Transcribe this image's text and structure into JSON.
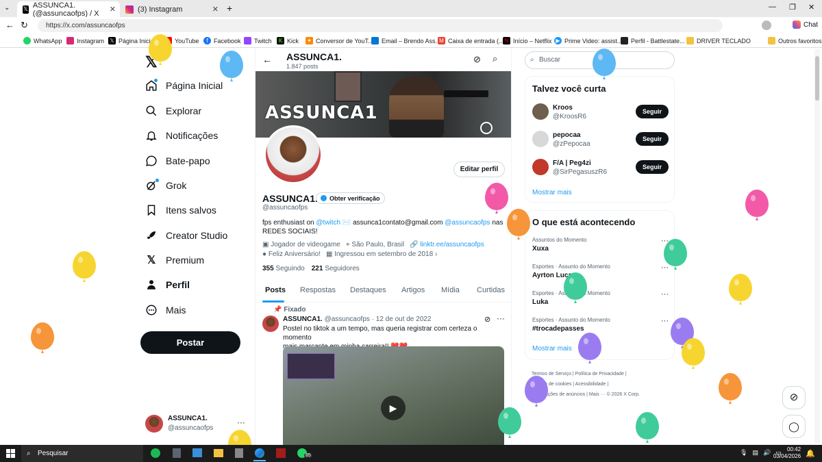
{
  "browser": {
    "tabs": [
      {
        "title": "ASSUNCA1. (@assuncaofps) / X"
      },
      {
        "title": "(3) Instagram"
      }
    ],
    "url": "https://x.com/assuncaofps",
    "chat_label": "Chat",
    "bookmarks": [
      "WhatsApp",
      "Instagram",
      "Página Inicial / X",
      "YouTube",
      "Facebook",
      "Twitch",
      "Kick",
      "Conversor de YouT...",
      "Email – Brendo Ass...",
      "Caixa de entrada (...",
      "Início – Netflix",
      "Prime Video: assist...",
      "Perfil - Battlestate...",
      "DRIVER TECLADO"
    ],
    "other_favorites": "Outros favoritos"
  },
  "sidebar": {
    "items": [
      {
        "label": "Página Inicial",
        "icon": "home-icon"
      },
      {
        "label": "Explorar",
        "icon": "search-icon"
      },
      {
        "label": "Notificações",
        "icon": "bell-icon"
      },
      {
        "label": "Bate-papo",
        "icon": "chat-icon"
      },
      {
        "label": "Grok",
        "icon": "grok-icon"
      },
      {
        "label": "Itens salvos",
        "icon": "bookmark-icon"
      },
      {
        "label": "Creator Studio",
        "icon": "rocket-icon"
      },
      {
        "label": "Premium",
        "icon": "x-logo-icon"
      },
      {
        "label": "Perfil",
        "icon": "person-icon"
      },
      {
        "label": "Mais",
        "icon": "more-icon"
      }
    ],
    "post_button": "Postar",
    "account": {
      "name": "ASSUNCA1.",
      "handle": "@assuncaofps"
    }
  },
  "profile": {
    "header_name": "ASSUNCA1.",
    "posts_count": "1.847 posts",
    "banner_text": "ASSUNCA1",
    "edit_button": "Editar perfil",
    "name": "ASSUNCA1.",
    "verify_button": "Obter verificação",
    "handle": "@assuncaofps",
    "bio_1": "fps enthusiast on",
    "bio_twitch": "@twitch",
    "bio_2": "assunca1contato@gmail.com",
    "bio_mention": "@assuncaofps",
    "bio_3": "nas",
    "bio_4": "REDES SOCIAIS!",
    "category": "Jogador de videogame",
    "location": "São Paulo, Brasil",
    "link": "linktr.ee/assuncaofps",
    "birthday": "Feliz Aniversário!",
    "joined": "Ingressou em setembro de 2018",
    "following_count": "355",
    "following_label": "Seguindo",
    "followers_count": "221",
    "followers_label": "Seguidores",
    "tabs": [
      "Posts",
      "Respostas",
      "Destaques",
      "Artigos",
      "Mídia",
      "Curtidas"
    ]
  },
  "pinned_post": {
    "pinned_label": "Fixado",
    "name": "ASSUNCA1.",
    "handle_date": "@assuncaofps · 12 de out de 2022",
    "text_1": "Postel no tiktok a um tempo, mas queria registrar com certeza o momento",
    "text_2": "mais marcante em minha carreira!! ❤️❤️"
  },
  "right": {
    "search_placeholder": "Buscar",
    "who_to_follow_title": "Talvez você curta",
    "suggestions": [
      {
        "name": "Kroos",
        "handle": "@KroosR6"
      },
      {
        "name": "pepocaa",
        "handle": "@zPepocaa"
      },
      {
        "name": "F/A | Peg4zi",
        "handle": "@SirPegasuszR6"
      }
    ],
    "follow_label": "Seguir",
    "show_more": "Mostrar mais",
    "trends_title": "O que está acontecendo",
    "trends": [
      {
        "context": "Assuntos do Momento",
        "topic": "Xuxa"
      },
      {
        "context": "Esportes · Assunto do Momento",
        "topic": "Ayrton Lucas"
      },
      {
        "context": "Esportes · Assunto do Momento",
        "topic": "Luka"
      },
      {
        "context": "Esportes · Assunto do Momento",
        "topic": "#trocadepasses"
      }
    ],
    "footer_1": "Termos de Serviço  |  Política de Privacidade  |",
    "footer_2": "Política de cookies  |  Acessibilidade  |",
    "footer_3": "Informações de anúncios  |  Mais ···  © 2026 X Corp."
  },
  "taskbar": {
    "search": "Pesquisar",
    "time": "00:42",
    "date": "03/04/2026",
    "badge": "85"
  },
  "colors": {
    "accent": "#1d9bf0",
    "dark": "#0f1419",
    "muted": "#536471"
  }
}
